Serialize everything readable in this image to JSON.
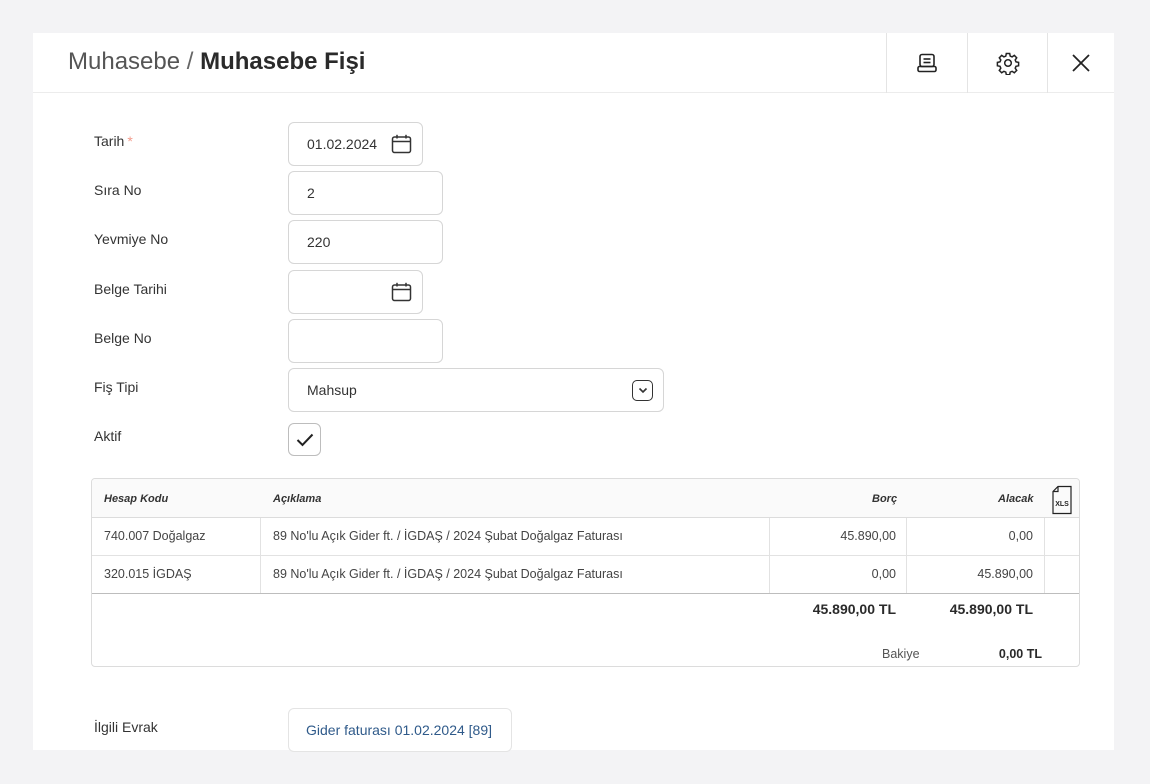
{
  "header": {
    "breadcrumb_parent": "Muhasebe",
    "breadcrumb_separator": "/",
    "title": "Muhasebe Fişi",
    "icons": [
      "print-icon",
      "gear-icon",
      "close-icon"
    ]
  },
  "form": {
    "tarih": {
      "label": "Tarih",
      "required_mark": "*",
      "value": "01.02.2024"
    },
    "sira_no": {
      "label": "Sıra No",
      "value": "2"
    },
    "yevmiye_no": {
      "label": "Yevmiye No",
      "value": "220"
    },
    "belge_tarihi": {
      "label": "Belge Tarihi",
      "value": ""
    },
    "belge_no": {
      "label": "Belge No",
      "value": ""
    },
    "fis_tipi": {
      "label": "Fiş Tipi",
      "value": "Mahsup"
    },
    "aktif": {
      "label": "Aktif",
      "checked": true
    }
  },
  "table": {
    "columns": [
      "Hesap Kodu",
      "Açıklama",
      "Borç",
      "Alacak"
    ],
    "export_icon": "xls-export-icon",
    "rows": [
      {
        "hesap_kodu": "740.007 Doğalgaz",
        "aciklama": "89 No'lu Açık Gider ft. / İGDAŞ / 2024 Şubat Doğalgaz Faturası",
        "borc": "45.890,00",
        "alacak": "0,00"
      },
      {
        "hesap_kodu": "320.015 İGDAŞ",
        "aciklama": "89 No'lu Açık Gider ft. / İGDAŞ / 2024 Şubat Doğalgaz Faturası",
        "borc": "0,00",
        "alacak": "45.890,00"
      }
    ],
    "total_borc": "45.890,00 TL",
    "total_alacak": "45.890,00 TL",
    "bakiye_label": "Bakiye",
    "bakiye_value": "0,00 TL"
  },
  "related": {
    "label": "İlgili Evrak",
    "link": "Gider faturası 01.02.2024 [89]"
  },
  "colors": {
    "accent_link": "#2f5a8a",
    "required": "#f29a8a"
  }
}
